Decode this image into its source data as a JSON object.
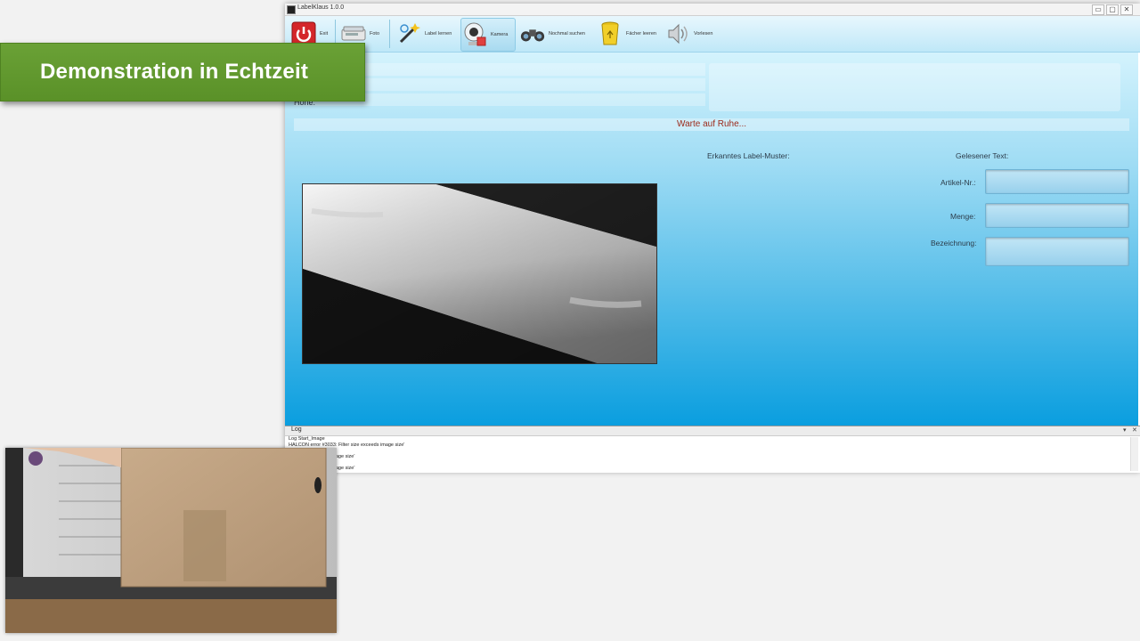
{
  "window": {
    "title": "LabelKlaus 1.0.0",
    "controls": [
      "▭",
      "▢",
      "✕"
    ]
  },
  "toolbar": {
    "buttons": [
      {
        "label": "Exit",
        "icon": "power-icon"
      },
      {
        "label": "Foto",
        "icon": "scanner-icon"
      },
      {
        "label": "Label lernen",
        "icon": "magic-wand-icon"
      },
      {
        "label": "Kamera",
        "icon": "webcam-icon",
        "active": true
      },
      {
        "label": "Nochmal suchen",
        "icon": "binoculars-icon"
      },
      {
        "label": "Fächer leeren",
        "icon": "recycle-bin-icon"
      },
      {
        "label": "Vorlesen",
        "icon": "speaker-icon"
      }
    ]
  },
  "form": {
    "fields": [
      "Höhe:"
    ]
  },
  "status": {
    "text": "Warte auf Ruhe..."
  },
  "detection": {
    "pattern_label": "Erkanntes Label-Muster:",
    "read_text_label": "Gelesener Text:",
    "fields": [
      {
        "label": "Artikel-Nr.:",
        "value": ""
      },
      {
        "label": "Menge:",
        "value": ""
      },
      {
        "label": "Bezeichnung:",
        "value": ""
      }
    ]
  },
  "log": {
    "title": "Log",
    "controls": [
      "▾",
      "✕"
    ],
    "lines": [
      "Log   Start_Image",
      "HALCON error #3033: Filter size exceeds image size'",
      "                              Filter size exceeds image size'",
      "                              Filter size exceeds image size'"
    ]
  },
  "banner": {
    "text": "Demonstration in Echtzeit"
  },
  "colors": {
    "banner_green": "#5f9a2e",
    "status_text": "#9b2a1a",
    "content_gradient_top": "#d4f3fd",
    "content_gradient_bottom": "#0a9edf"
  }
}
